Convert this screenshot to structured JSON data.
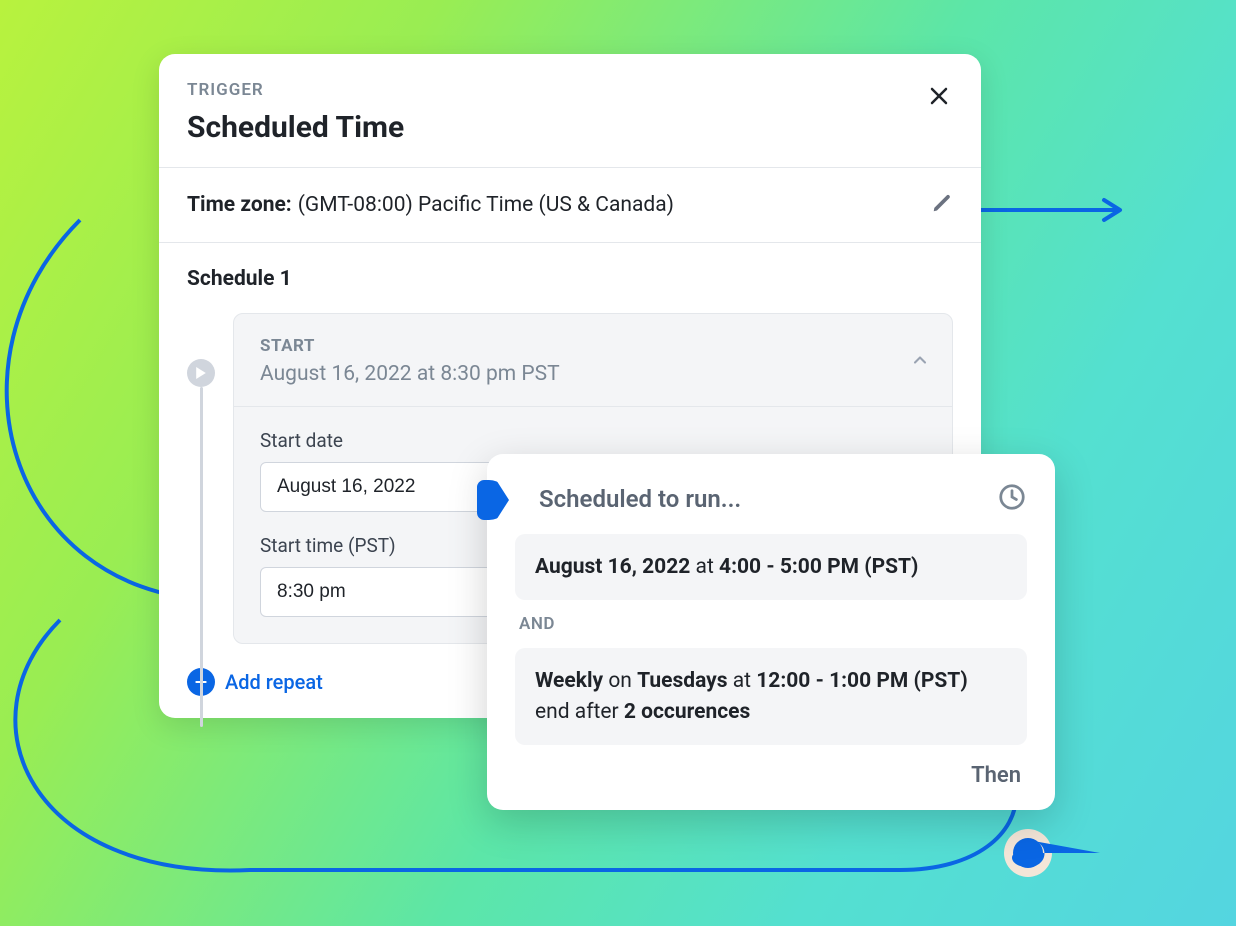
{
  "trigger": {
    "eyebrow": "TRIGGER",
    "title": "Scheduled Time"
  },
  "timezone": {
    "label": "Time zone:",
    "value": "(GMT-08:00) Pacific Time (US & Canada)"
  },
  "schedule": {
    "title": "Schedule 1",
    "start": {
      "eyebrow": "START",
      "datetime": "August 16, 2022 at 8:30 pm PST",
      "fields": {
        "start_date_label": "Start date",
        "start_date_value": "August 16, 2022",
        "start_time_label": "Start time (PST)",
        "start_time_value": "8:30 pm"
      }
    }
  },
  "actions": {
    "add_repeat": "Add repeat"
  },
  "popover": {
    "title": "Scheduled to run...",
    "block1": {
      "date": "August 16, 2022",
      "at": "at",
      "time": "4:00 - 5:00 PM (PST)"
    },
    "and": "AND",
    "block2": {
      "freq": "Weekly",
      "on": "on",
      "days": "Tuesdays",
      "at": "at",
      "time": "12:00 - 1:00 PM (PST)",
      "end": "end after",
      "occur": "2 occurences"
    },
    "then": "Then"
  }
}
